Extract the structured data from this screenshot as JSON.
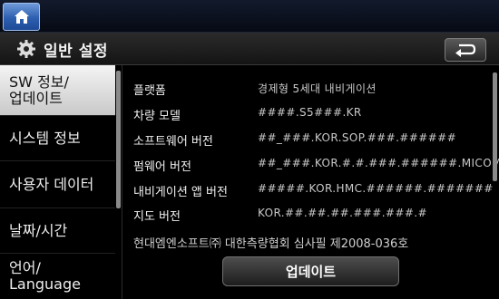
{
  "topbar": {
    "home_icon": "home-icon"
  },
  "header": {
    "title": "일반 설정",
    "settings_icon": "gear-icon",
    "back_icon": "back-arrow-icon"
  },
  "sidebar": {
    "items": [
      {
        "label_line1": "SW 정보/",
        "label_line2": "업데이트",
        "active": true
      },
      {
        "label": "시스템 정보"
      },
      {
        "label": "사용자 데이터"
      },
      {
        "label": "날짜/시간"
      },
      {
        "label_line1": "언어/",
        "label_line2": "Language"
      }
    ]
  },
  "info": {
    "rows": [
      {
        "label": "플랫폼",
        "value": "경제형 5세대 내비게이션"
      },
      {
        "label": "차량 모델",
        "value": "####.S5###.KR"
      },
      {
        "label": "소프트웨어 버전",
        "value": "##_###.KOR.SOP.###.######"
      },
      {
        "label": "펌웨어 버전",
        "value": "##_###.KOR.#.#.###.######.MICOM"
      },
      {
        "label": "내비게이션 앱 버전",
        "value": "#####.KOR.HMC.######.#######"
      },
      {
        "label": "지도 버전",
        "value": "KOR.##.##.##.###.###.#"
      }
    ],
    "footnote": "현대엠엔소프트㈜ 대한측량협회 심사필 제2008-036호"
  },
  "actions": {
    "update_label": "업데이트"
  },
  "colors": {
    "home_button": "#2d5fb0",
    "active_item": "#e6e6e6"
  }
}
